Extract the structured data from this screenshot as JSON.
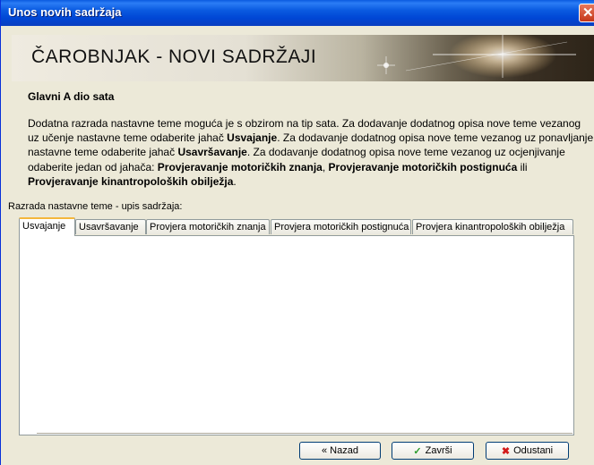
{
  "window": {
    "title": "Unos novih sadržaja"
  },
  "banner": {
    "title": "ČAROBNJAK - NOVI SADRŽAJI"
  },
  "section": {
    "title": "Glavni A dio sata"
  },
  "description": {
    "p1": "Dodatna razrada nastavne teme moguća je s obzirom na tip sata. Za dodavanje dodatnog opisa nove teme vezanog uz učenje nastavne teme odaberite jahač ",
    "b1": "Usvajanje",
    "p2": ". Za dodavanje dodatnog opisa nove teme vezanog uz ponavljanje nastavne teme odaberite jahač ",
    "b2": "Usavršavanje",
    "p3": ". Za dodavanje dodatnog opisa nove teme vezanog uz ocjenjivanje odaberite jedan od jahača: ",
    "b3": "Provjeravanje motoričkih znanja",
    "p4": ", ",
    "b4": "Provjeravanje motoričkih postignuća",
    "p5": " ili ",
    "b5": "Provjeravanje kinantropoloških obilježja",
    "p6": "."
  },
  "razrada_label": "Razrada nastavne teme - upis sadržaja:",
  "tabs": [
    {
      "label": "Usvajanje",
      "active": true
    },
    {
      "label": "Usavršavanje"
    },
    {
      "label": "Provjera motoričkih znanja"
    },
    {
      "label": "Provjera motoričkih postignuća"
    },
    {
      "label": "Provjera kinantropoloških obilježja"
    }
  ],
  "buttons": {
    "back": "« Nazad",
    "finish": "Završi",
    "cancel": "Odustani"
  },
  "colors": {
    "titlebar": "#0a5ae0",
    "tab_active_accent": "#f4b73c",
    "finish_icon": "#2a9a2a",
    "cancel_icon": "#d21a1a"
  }
}
